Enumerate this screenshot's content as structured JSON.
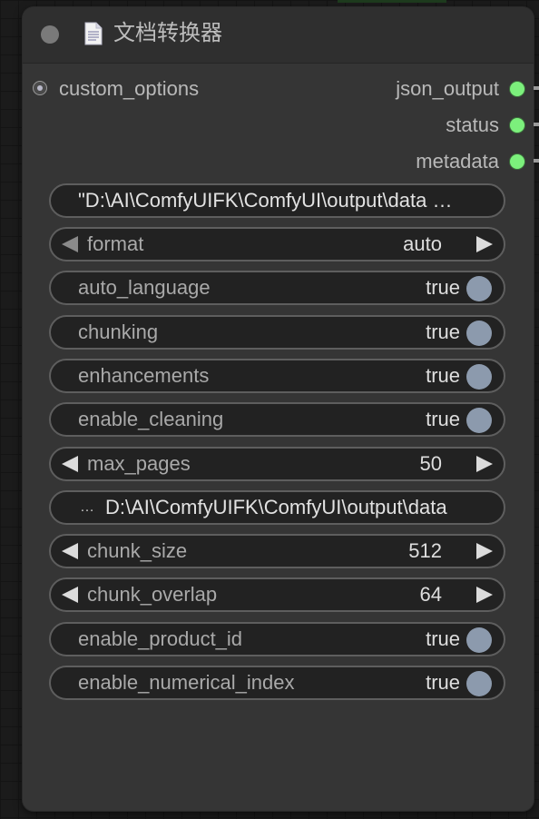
{
  "node": {
    "title": "文档转换器"
  },
  "inputs": [
    {
      "label": "custom_options"
    }
  ],
  "outputs": [
    {
      "label": "json_output"
    },
    {
      "label": "status"
    },
    {
      "label": "metadata"
    }
  ],
  "widgets": {
    "input_path": {
      "value": "\"D:\\AI\\ComfyUIFK\\ComfyUI\\output\\data …"
    },
    "format": {
      "label": "format",
      "value": "auto"
    },
    "auto_language": {
      "label": "auto_language",
      "value": "true"
    },
    "chunking": {
      "label": "chunking",
      "value": "true"
    },
    "enhancements": {
      "label": "enhancements",
      "value": "true"
    },
    "enable_cleaning": {
      "label": "enable_cleaning",
      "value": "true"
    },
    "max_pages": {
      "label": "max_pages",
      "value": "50"
    },
    "output_dir": {
      "prefix": "…",
      "value": "D:\\AI\\ComfyUIFK\\ComfyUI\\output\\data"
    },
    "chunk_size": {
      "label": "chunk_size",
      "value": "512"
    },
    "chunk_overlap": {
      "label": "chunk_overlap",
      "value": "64"
    },
    "enable_product_id": {
      "label": "enable_product_id",
      "value": "true"
    },
    "enable_numerical_index": {
      "label": "enable_numerical_index",
      "value": "true"
    }
  },
  "colors": {
    "output_dot": "#7cf07c",
    "toggle_knob": "#8c9aad",
    "node_bg": "#353535"
  },
  "icons": {
    "title_icon": "document-icon",
    "collapse": "collapse-dot-icon"
  }
}
